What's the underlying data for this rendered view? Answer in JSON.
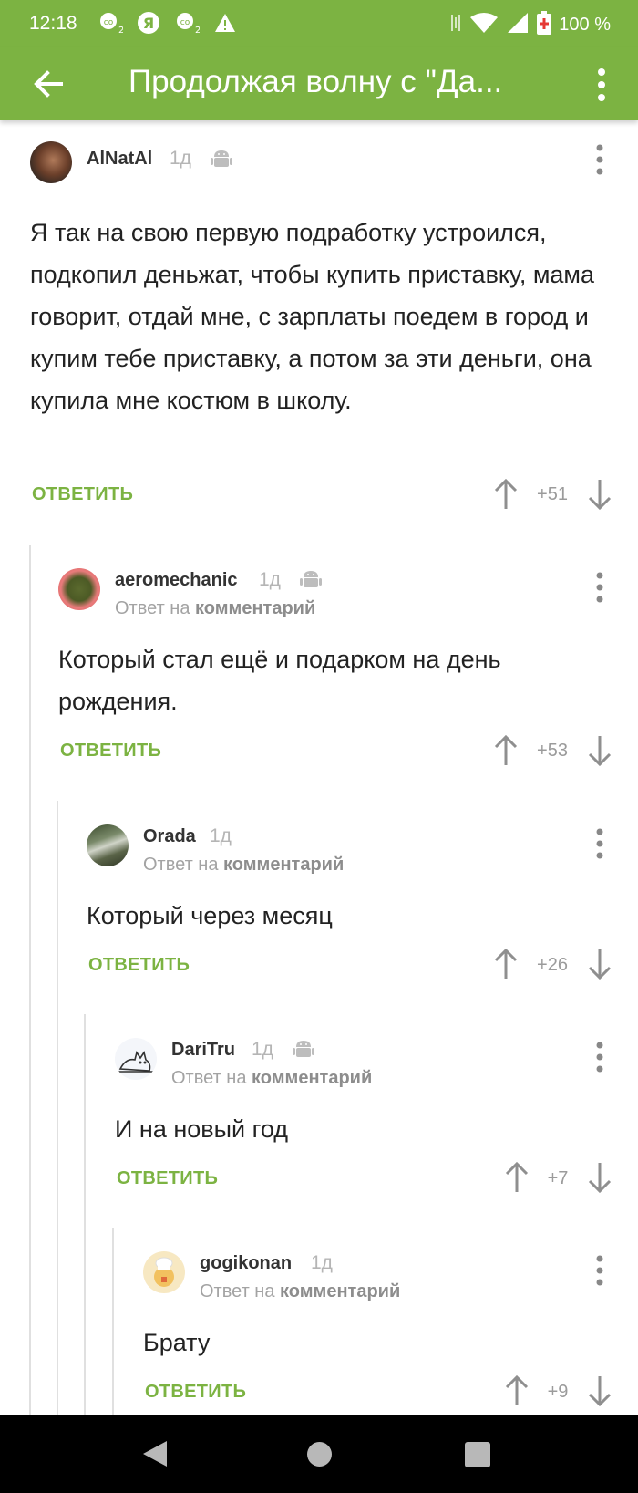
{
  "status_bar": {
    "time": "12:18",
    "icons": [
      "co2-notification-icon",
      "yandex-icon",
      "co2-notification-icon",
      "warning-icon"
    ],
    "battery": "100 %"
  },
  "app_bar": {
    "title": "Продолжая волну с \"Да...",
    "back_icon": "arrow-left-icon",
    "more_icon": "more-vertical-icon"
  },
  "colors": {
    "accent": "#7cb342",
    "muted": "#a3a3a3",
    "thread_line": "#e0e0e0"
  },
  "reply_prefix": "Ответ на",
  "reply_target": "комментарий",
  "reply_label": "ОТВЕТИТЬ",
  "comments": [
    {
      "author": "AlNatAl",
      "time": "1д",
      "platform_icon": "android-icon",
      "text": "Я так на свою первую подработку устроился, подкопил деньжат, чтобы купить приставку, мама говорит, отдай мне, с зарплаты поедем в город и купим тебе приставку, а потом за эти деньги, она купила мне костюм в школу.",
      "rating": "+51"
    },
    {
      "author": "aeromechanic",
      "time": "1д",
      "platform_icon": "android-icon",
      "text": "Который стал ещё и подарком на день рождения.",
      "rating": "+53"
    },
    {
      "author": "Orada",
      "time": "1д",
      "text": "Который через месяц",
      "rating": "+26"
    },
    {
      "author": "DariTru",
      "time": "1д",
      "platform_icon": "android-icon",
      "text": "И на новый год",
      "rating": "+7"
    },
    {
      "author": "gogikonan",
      "time": "1д",
      "text": "Брату",
      "rating": "+9"
    }
  ],
  "nav_bar": {
    "back_icon": "triangle-back-icon",
    "home_icon": "circle-home-icon",
    "recents_icon": "square-recents-icon"
  }
}
